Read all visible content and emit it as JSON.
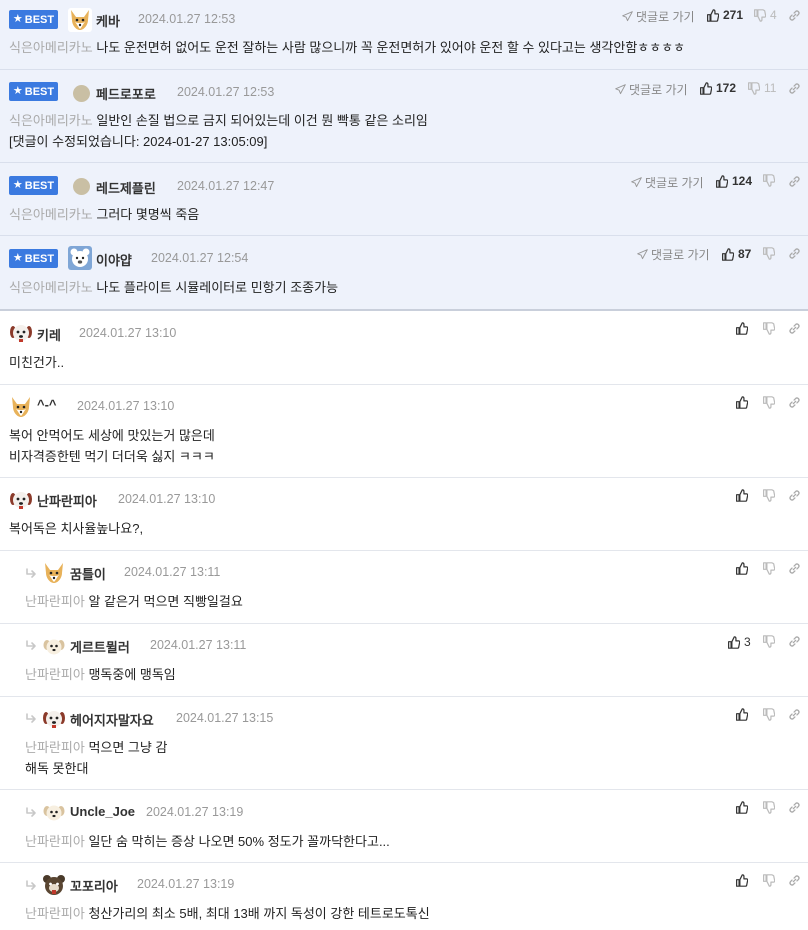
{
  "labels": {
    "best": "BEST",
    "goto_reply": "댓글로 가기"
  },
  "colors": {
    "best_badge": "#3b7ae0",
    "best_bg": "#eef2fb",
    "mention": "#aaaaaa"
  },
  "comments": [
    {
      "nick": "케바",
      "date": "2024.01.27 12:53",
      "mention": "식은아메리카노",
      "text": "나도 운전면허 없어도 운전 잘하는 사람 많으니까 꼭 운전면허가 있어야 운전 할 수 있다고는 생각안함ㅎㅎㅎㅎ",
      "likes": "271",
      "dislikes": "4",
      "avatar": "fox-icon"
    },
    {
      "nick": "페드로포로",
      "date": "2024.01.27 12:53",
      "mention": "식은아메리카노",
      "text": "일반인 손질 법으로 금지 되어있는데 이건 뭔 빡통 같은 소리임",
      "edit_note": "[댓글이 수정되었습니다: 2024-01-27 13:05:09]",
      "likes": "172",
      "dislikes": "11",
      "avatar": "round-avatar"
    },
    {
      "nick": "레드제플린",
      "date": "2024.01.27 12:47",
      "mention": "식은아메리카노",
      "text": "그러다 몇명씩 죽음",
      "likes": "124",
      "dislikes": "",
      "avatar": "round-avatar"
    },
    {
      "nick": "이야얍",
      "date": "2024.01.27 12:54",
      "mention": "식은아메리카노",
      "text": "나도 플라이트 시뮬레이터로 민항기 조종가능",
      "likes": "87",
      "dislikes": "",
      "avatar": "bear-icon"
    },
    {
      "nick": "키레",
      "date": "2024.01.27 13:10",
      "text": "미친건가..",
      "likes": "",
      "avatar": "dog-icon"
    },
    {
      "nick": "^-^",
      "date": "2024.01.27 13:10",
      "text": "복어 안먹어도 세상에 맛있는거 많은데",
      "text2": "비자격증한텐 먹기 더더욱 싫지 ㅋㅋㅋ",
      "likes": "",
      "avatar": "fox-icon"
    },
    {
      "nick": "난파란피아",
      "date": "2024.01.27 13:10",
      "text": "복어독은 치사율높나요?,",
      "likes": "",
      "avatar": "dog-icon"
    },
    {
      "nick": "꿈틀이",
      "date": "2024.01.27 13:11",
      "mention": "난파란피아",
      "text": "알 같은거 먹으면 직빵일걸요",
      "likes": "",
      "avatar": "fox-icon"
    },
    {
      "nick": "게르트뮐러",
      "date": "2024.01.27 13:11",
      "mention": "난파란피아",
      "text": "맹독중에 맹독임",
      "likes": "3",
      "avatar": "puppy-icon"
    },
    {
      "nick": "헤어지자말자요",
      "date": "2024.01.27 13:15",
      "mention": "난파란피아",
      "text": "먹으면 그냥 감",
      "text2": "해독 못한대",
      "likes": "",
      "avatar": "dog-icon"
    },
    {
      "nick": "Uncle_Joe",
      "date": "2024.01.27 13:19",
      "mention": "난파란피아",
      "text": "일단 숨 막히는 증상 나오면 50% 정도가 꼴까닥한다고...",
      "likes": "",
      "avatar": "puppy-icon"
    },
    {
      "nick": "꼬포리아",
      "date": "2024.01.27 13:19",
      "mention": "난파란피아",
      "text": "청산가리의 최소 5배, 최대 13배 까지 독성이 강한 테트로도톡신",
      "likes": "",
      "avatar": "bear-dark-icon"
    }
  ]
}
